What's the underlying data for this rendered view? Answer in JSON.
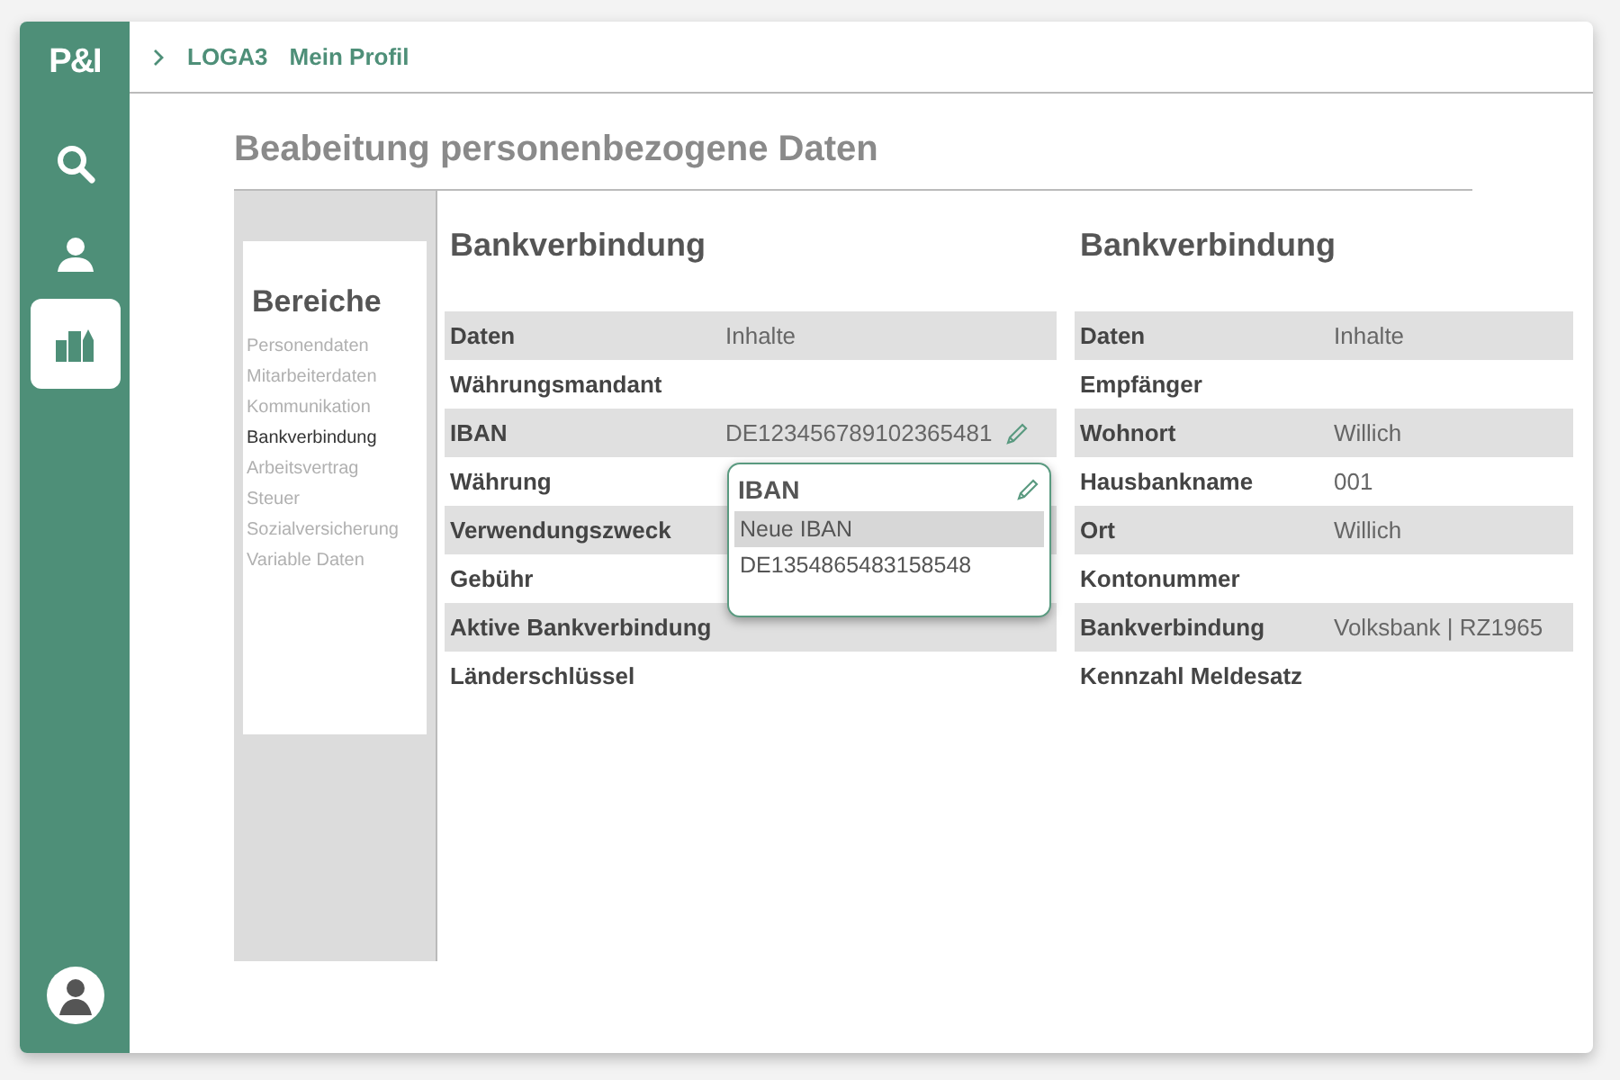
{
  "nav": {
    "logo": "P&I",
    "items": [
      {
        "kind": "search",
        "selected": false
      },
      {
        "kind": "user",
        "selected": false
      },
      {
        "kind": "buildings",
        "selected": true
      }
    ]
  },
  "breadcrumb": [
    "LOGA3",
    "Mein Profil"
  ],
  "title": "Beabeitung personenbezogene Daten",
  "areas": {
    "heading": "Bereiche",
    "items": [
      {
        "label": "Personendaten",
        "selected": false
      },
      {
        "label": "Mitarbeiterdaten",
        "selected": false
      },
      {
        "label": "Kommunikation",
        "selected": false
      },
      {
        "label": "Bankverbindung",
        "selected": true
      },
      {
        "label": "Arbeitsvertrag",
        "selected": false
      },
      {
        "label": "Steuer",
        "selected": false
      },
      {
        "label": "Sozialversicherung",
        "selected": false
      },
      {
        "label": "Variable Daten",
        "selected": false
      }
    ]
  },
  "tables": [
    {
      "heading": "Bankverbindung",
      "columns": [
        "Daten",
        "Inhalte"
      ],
      "rows": [
        {
          "label": "Währungsmandant"
        },
        {
          "label": "IBAN",
          "value": "DE123456789102365481",
          "editable": true
        },
        {
          "label": "Währung"
        },
        {
          "label": "Verwendungszweck"
        },
        {
          "label": "Gebühr"
        },
        {
          "label": "Aktive Bankverbindung"
        },
        {
          "label": "Länderschlüssel"
        }
      ]
    },
    {
      "heading": "Bankverbindung",
      "columns": [
        "Daten",
        "Inhalte"
      ],
      "rows": [
        {
          "label": "Empfänger"
        },
        {
          "label": "Wohnort",
          "value": "Willich"
        },
        {
          "label": "Hausbankname",
          "value": "001"
        },
        {
          "label": "Ort",
          "value": "Willich"
        },
        {
          "label": "Kontonummer"
        },
        {
          "label": "Bankverbindung",
          "value": "Volksbank | RZ1965"
        },
        {
          "label": "Kennzahl Meldesatz"
        }
      ]
    }
  ],
  "popup": {
    "title": "IBAN",
    "options": [
      {
        "text": "Neue IBAN",
        "selected": true
      },
      {
        "text": "DE1354865483158548",
        "selected": false
      }
    ]
  }
}
